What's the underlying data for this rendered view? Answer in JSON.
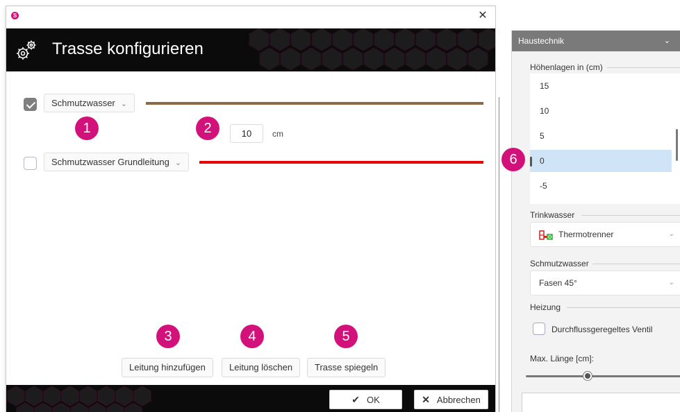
{
  "dialog": {
    "title": "Trasse konfigurieren",
    "close_glyph": "✕",
    "app_logo_text": "S",
    "rows": [
      {
        "checked": true,
        "pipe_type": "Schmutzwasser",
        "line_color": "#8b6b45"
      },
      {
        "checked": false,
        "pipe_type": "Schmutzwasser Grundleitung",
        "line_color": "#e60000"
      }
    ],
    "offset": {
      "value": "10",
      "unit": "cm"
    },
    "buttons": {
      "add_line": "Leitung hinzufügen",
      "delete_line": "Leitung löschen",
      "mirror_route": "Trasse spiegeln"
    },
    "footer": {
      "ok": "OK",
      "cancel": "Abbrechen"
    }
  },
  "badges": [
    "1",
    "2",
    "3",
    "4",
    "5",
    "6"
  ],
  "right_panel": {
    "header": "Haustechnik",
    "height_levels": {
      "label": "Höhenlagen in (cm)",
      "items": [
        "15",
        "10",
        "5",
        "0",
        "-5"
      ],
      "selected": "0"
    },
    "drinking_water": {
      "label": "Trinkwasser",
      "value": "Thermotrenner"
    },
    "waste_water": {
      "label": "Schmutzwasser",
      "value": "Fasen 45°"
    },
    "heating": {
      "label": "Heizung",
      "checkbox_label": "Durchflussgeregeltes Ventil",
      "checked": false
    },
    "max_length": {
      "label": "Max. Länge [cm]:"
    }
  },
  "colors": {
    "accent": "#d2127a",
    "header_bg": "#0b0b0b",
    "panel_header_bg": "#7a7a7a",
    "selected_row": "#cfe4f7"
  },
  "icons": {
    "settings": "gears-icon",
    "ok": "checkmark-icon",
    "cancel": "x-icon",
    "combo": "chevron-down-icon",
    "thermotrenner": "thermotrenner-icon"
  }
}
